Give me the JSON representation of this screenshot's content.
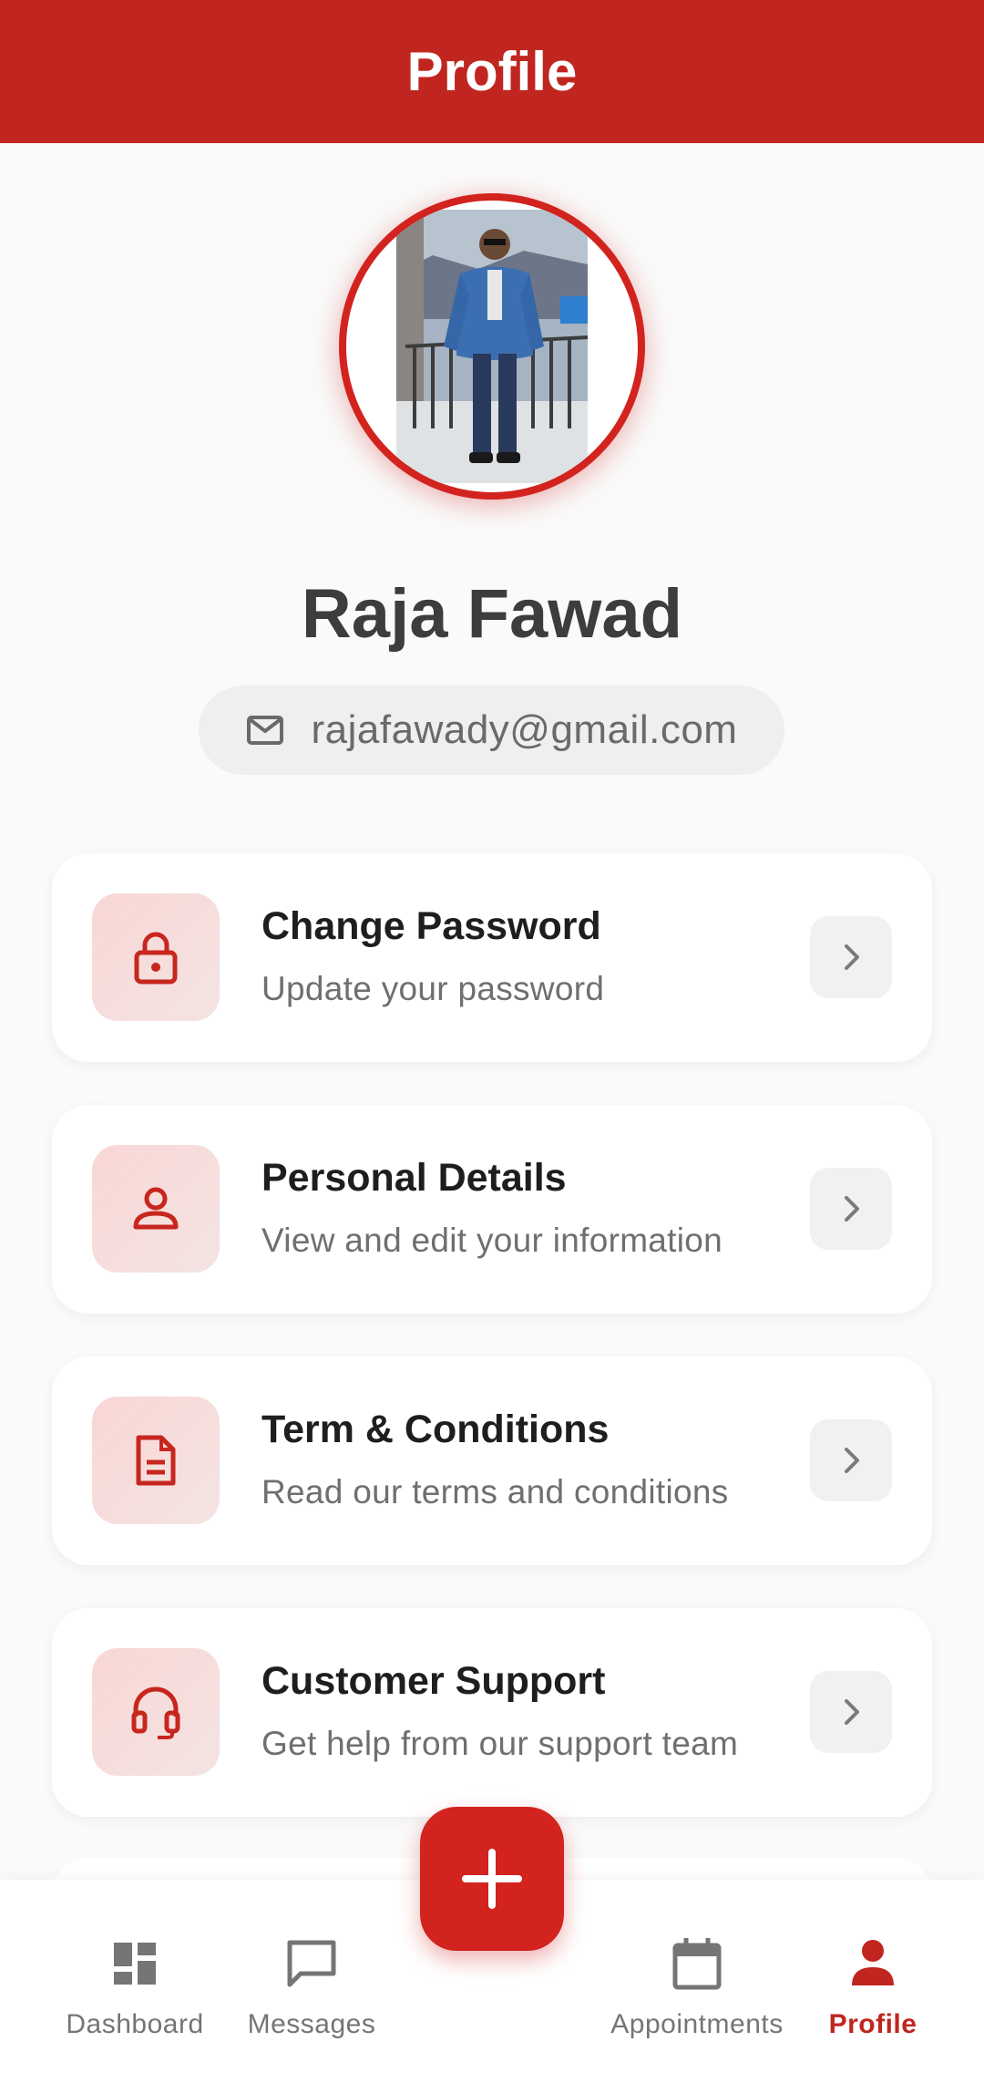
{
  "header": {
    "title": "Profile"
  },
  "profile": {
    "name": "Raja Fawad",
    "email": "rajafawady@gmail.com"
  },
  "menu": [
    {
      "title": "Change Password",
      "subtitle": "Update your password",
      "icon": "lock-icon"
    },
    {
      "title": "Personal Details",
      "subtitle": "View and edit your information",
      "icon": "person-icon"
    },
    {
      "title": "Term & Conditions",
      "subtitle": "Read our terms and conditions",
      "icon": "document-icon"
    },
    {
      "title": "Customer Support",
      "subtitle": "Get help from our support team",
      "icon": "headset-icon"
    }
  ],
  "bottom_nav": [
    {
      "label": "Dashboard",
      "icon": "dashboard-icon",
      "active": false
    },
    {
      "label": "Messages",
      "icon": "message-icon",
      "active": false
    },
    {
      "label": "Appointments",
      "icon": "calendar-icon",
      "active": false
    },
    {
      "label": "Profile",
      "icon": "person-icon",
      "active": true
    }
  ],
  "fab": {
    "icon": "plus-icon"
  },
  "colors": {
    "primary": "#c0261f",
    "accent": "#d2231f",
    "background": "#fafafa"
  }
}
